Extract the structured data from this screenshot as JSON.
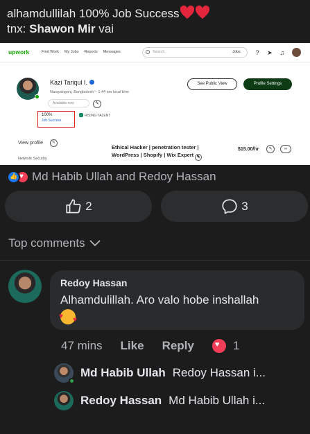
{
  "post": {
    "line1": "alhamdullilah 100% Job Success",
    "line2_prefix": "tnx:",
    "line2_name": "Shawon Mir",
    "line2_suffix": "vai"
  },
  "upwork": {
    "logo": "upwork",
    "nav_links": [
      "Find Work",
      "My Jobs",
      "Reports",
      "Messages"
    ],
    "search_placeholder": "Search",
    "search_scope": "Jobs",
    "profile": {
      "name": "Kazi Tariqul I.",
      "location": "Narayanganj, Bangladesh – 1:44 am local time",
      "availability": "Available now",
      "job_success_pct": "100%",
      "job_success_label": "Job Success",
      "badge": "RISING TALENT",
      "btn_public": "See Public View",
      "btn_settings": "Profile Settings",
      "view_profile": "View profile",
      "network_security": "Network Security",
      "title": "Ethical Hacker | penetration tester | WordPress | Shopify | Wix Expert",
      "rate": "$15.00/hr"
    }
  },
  "reactions": {
    "names": "Md Habib Ullah and Redoy Hassan",
    "like_count": "2",
    "comment_count": "3"
  },
  "comments_header": "Top comments",
  "comment": {
    "author": "Redoy Hassan",
    "text": "Alhamdulillah. Aro valo hobe inshallah",
    "time": "47 mins",
    "like_label": "Like",
    "reply_label": "Reply",
    "reaction_count": "1"
  },
  "replies": [
    {
      "name": "Md Habib Ullah",
      "preview": "Redoy Hassan i..."
    },
    {
      "name": "Redoy Hassan",
      "preview": "Md Habib Ullah i..."
    }
  ],
  "colors": {
    "background": "#1c1c1d",
    "button_bg": "#2c2d2e",
    "love_red": "#f33e58",
    "like_blue": "#1877f2",
    "upwork_green": "#14a800"
  }
}
